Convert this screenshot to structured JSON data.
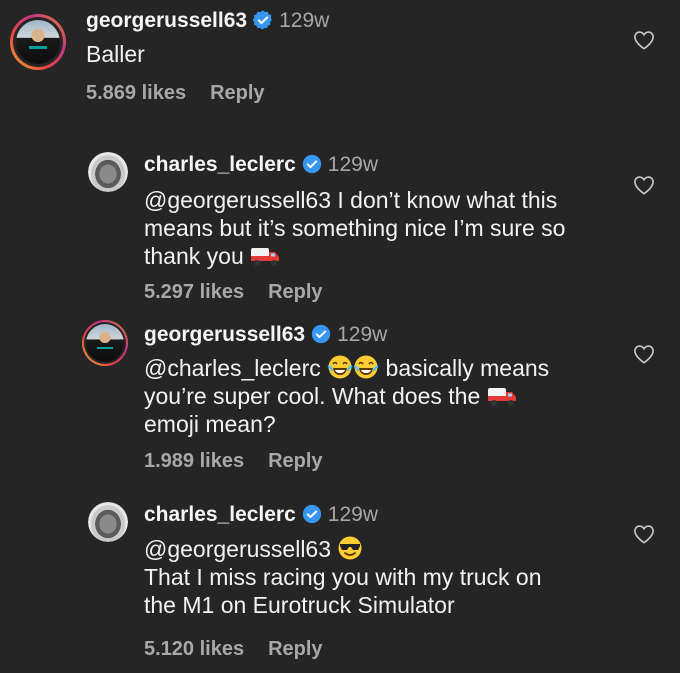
{
  "comments": [
    {
      "username": "georgerussell63",
      "time": "129w",
      "text": "Baller",
      "likes": "5.869 likes",
      "reply": "Reply",
      "avatar": "george-avatar",
      "reply_level": 0
    },
    {
      "username": "charles_leclerc",
      "time": "129w",
      "text_parts": [
        "@georgerussell63 I don’t know what this",
        "means but it’s something nice I’m sure so",
        "thank you"
      ],
      "emoji": "delivery-truck-emoji",
      "likes": "5.297 likes",
      "reply": "Reply",
      "avatar": "charles-avatar",
      "reply_level": 1
    },
    {
      "username": "georgerussell63",
      "time": "129w",
      "text_parts": [
        "@charles_leclerc",
        "basically means",
        "you’re super cool. What does the",
        "emoji mean?"
      ],
      "emojis": [
        "laughing-tears-emoji",
        "laughing-tears-emoji",
        "delivery-truck-emoji"
      ],
      "likes": "1.989 likes",
      "reply": "Reply",
      "avatar": "george-avatar",
      "reply_level": 1
    },
    {
      "username": "charles_leclerc",
      "time": "129w",
      "text_parts": [
        "@georgerussell63",
        "That I miss racing you with my truck on",
        "the M1 on Eurotruck Simulator"
      ],
      "emoji": "sunglasses-emoji",
      "likes": "5.120 likes",
      "reply": "Reply",
      "avatar": "charles-avatar",
      "reply_level": 1
    }
  ],
  "colors": {
    "background": "#252525",
    "text": "#f2f2f2",
    "secondary": "#a8a8a8",
    "verified": "#3797f0"
  }
}
